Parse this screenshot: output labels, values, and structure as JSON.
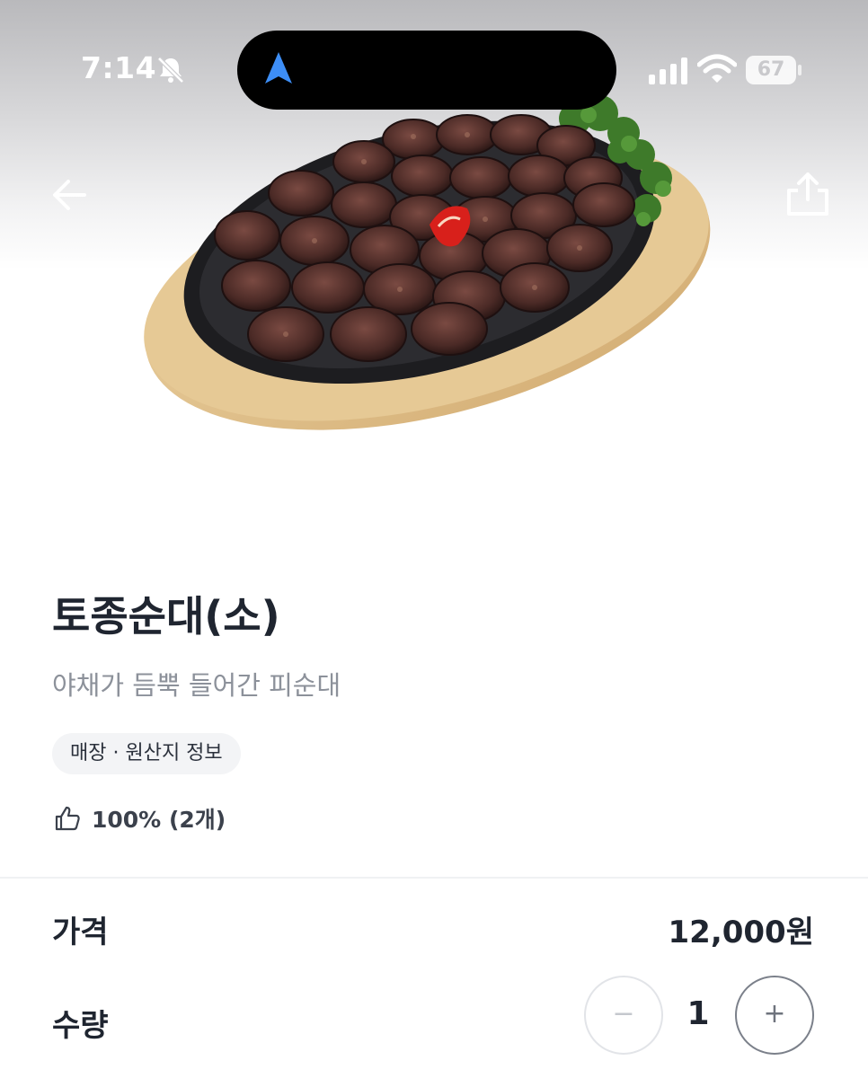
{
  "status_bar": {
    "time": "7:14",
    "battery": "67"
  },
  "icons": {
    "back": "arrow-left-icon",
    "share": "share-icon",
    "rating": "thumbs-up-icon"
  },
  "product": {
    "name": "토종순대(소)",
    "description": "야채가 듬뿍 들어간 피순대",
    "origin_chip": "매장 · 원산지 정보",
    "rating": "100% (2개)"
  },
  "order": {
    "price_label": "가격",
    "price": "12,000원",
    "quantity_label": "수량",
    "quantity": "1",
    "minus": "−",
    "plus": "+"
  },
  "colors": {
    "text_primary": "#1f2530",
    "text_secondary": "#8c919a",
    "chip_bg": "#f3f4f6"
  }
}
